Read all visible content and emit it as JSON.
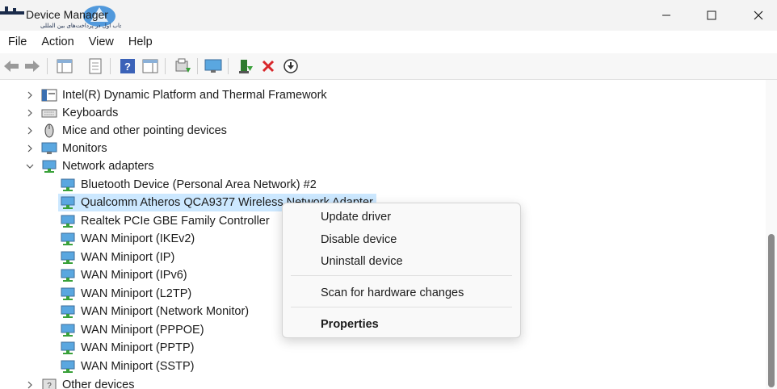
{
  "window": {
    "title": "Device Manager",
    "logo_text": "انتخاب اول در پرداخت‌های بین المللی",
    "controls": {
      "minimize": "minimize-icon",
      "maximize": "maximize-icon",
      "close": "close-icon"
    }
  },
  "menubar": {
    "items": [
      {
        "label": "File"
      },
      {
        "label": "Action"
      },
      {
        "label": "View"
      },
      {
        "label": "Help"
      }
    ]
  },
  "toolbar": {
    "buttons": [
      "back-icon",
      "forward-icon",
      "properties-pane-icon",
      "document-icon",
      "help-icon",
      "action-pane-icon",
      "scan-icon",
      "monitor-icon",
      "update-driver-icon",
      "uninstall-icon",
      "download-icon"
    ]
  },
  "tree": {
    "categories": [
      {
        "label": "Intel(R) Dynamic Platform and Thermal Framework",
        "expanded": false,
        "icon": "chip-icon"
      },
      {
        "label": "Keyboards",
        "expanded": false,
        "icon": "keyboard-icon"
      },
      {
        "label": "Mice and other pointing devices",
        "expanded": false,
        "icon": "mouse-icon"
      },
      {
        "label": "Monitors",
        "expanded": false,
        "icon": "monitor-icon"
      },
      {
        "label": "Network adapters",
        "expanded": true,
        "icon": "network-icon"
      }
    ],
    "network_adapters": [
      {
        "label": "Bluetooth Device (Personal Area Network) #2",
        "selected": false
      },
      {
        "label": "Qualcomm Atheros QCA9377 Wireless Network Adapter",
        "selected": true
      },
      {
        "label": "Realtek PCIe GBE Family Controller",
        "selected": false
      },
      {
        "label": "WAN Miniport (IKEv2)",
        "selected": false
      },
      {
        "label": "WAN Miniport (IP)",
        "selected": false
      },
      {
        "label": "WAN Miniport (IPv6)",
        "selected": false
      },
      {
        "label": "WAN Miniport (L2TP)",
        "selected": false
      },
      {
        "label": "WAN Miniport (Network Monitor)",
        "selected": false
      },
      {
        "label": "WAN Miniport (PPPOE)",
        "selected": false
      },
      {
        "label": "WAN Miniport (PPTP)",
        "selected": false
      },
      {
        "label": "WAN Miniport (SSTP)",
        "selected": false
      }
    ],
    "after": [
      {
        "label": "Other devices",
        "expanded": false,
        "icon": "unknown-device-icon"
      }
    ]
  },
  "context_menu": {
    "items": [
      {
        "label": "Update driver"
      },
      {
        "label": "Disable device"
      },
      {
        "label": "Uninstall device"
      },
      {
        "label": "Scan for hardware changes"
      },
      {
        "label": "Properties",
        "bold": true
      }
    ]
  },
  "colors": {
    "selection": "#cce8ff",
    "titlebar": "#f3f3f3",
    "logo_blue": "#3f8fd9",
    "uninstall_red": "#d8262a"
  }
}
